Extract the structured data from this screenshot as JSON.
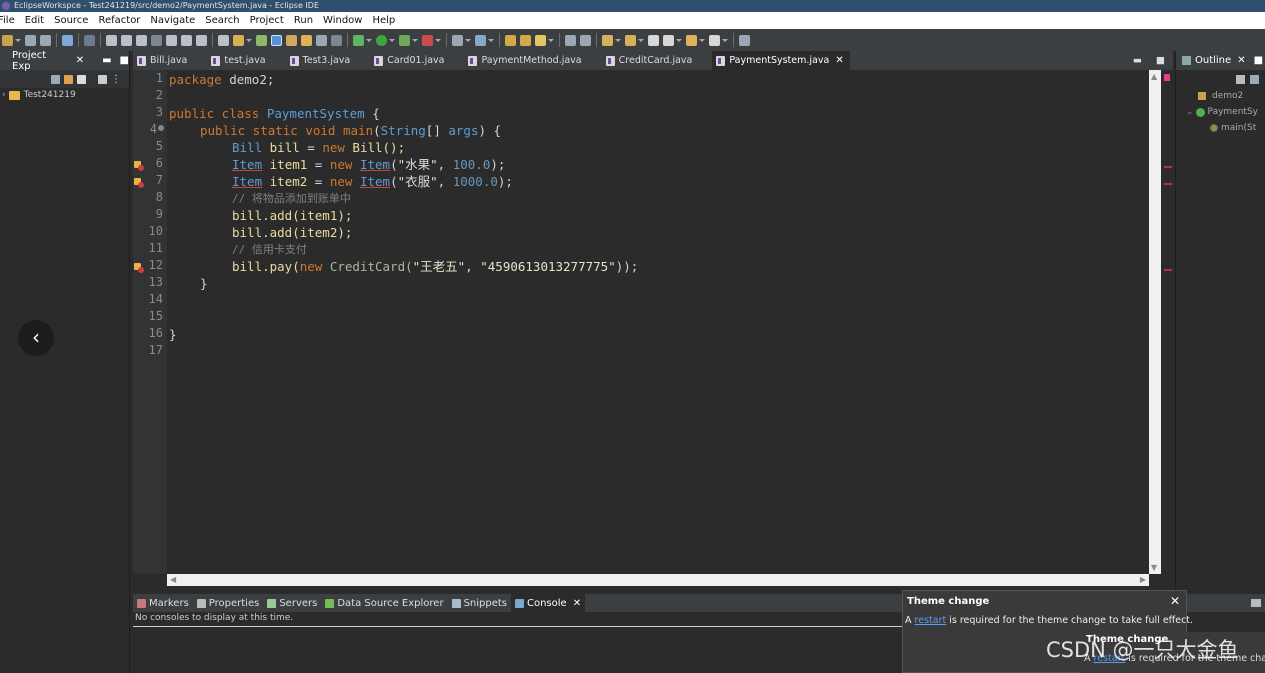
{
  "window": {
    "title": "EclipseWorkspce - Test241219/src/demo2/PaymentSystem.java - Eclipse IDE"
  },
  "menu": [
    "File",
    "Edit",
    "Source",
    "Refactor",
    "Navigate",
    "Search",
    "Project",
    "Run",
    "Window",
    "Help"
  ],
  "project_explorer": {
    "tab_label": "Project Exp",
    "project_name": "Test241219"
  },
  "editor_tabs": [
    {
      "label": "Bill.java",
      "active": false
    },
    {
      "label": "test.java",
      "active": false
    },
    {
      "label": "Test3.java",
      "active": false
    },
    {
      "label": "Card01.java",
      "active": false
    },
    {
      "label": "PaymentMethod.java",
      "active": false
    },
    {
      "label": "CreditCard.java",
      "active": false
    },
    {
      "label": "PaymentSystem.java",
      "active": true
    }
  ],
  "code": {
    "line_numbers": [
      "1",
      "2",
      "3",
      "4",
      "5",
      "6",
      "7",
      "8",
      "9",
      "10",
      "11",
      "12",
      "13",
      "14",
      "15",
      "16",
      "17"
    ],
    "l1_kw": "package",
    "l1_rest": " demo2;",
    "l3_kw": "public class",
    "l3_name": "PaymentSystem",
    "l3_rest": " {",
    "l4_kw": "public static void",
    "l4_fn": "main",
    "l4_p1": "(",
    "l4_type": "String",
    "l4_p2": "[] ",
    "l4_arg": "args",
    "l4_p3": ") {",
    "l5_type": "Bill",
    "l5_var": "bill",
    "l5_eq": " = ",
    "l5_new": "new",
    "l5_rest": " Bill();",
    "l6_type": "Item",
    "l6_var": "item1",
    "l6_eq": " = ",
    "l6_new": "new",
    "l6_type2": "Item",
    "l6_open": "(",
    "l6_str": "\"水果\"",
    "l6_comma": ", ",
    "l6_num": "100.0",
    "l6_close": ");",
    "l7_type": "Item",
    "l7_var": "item2",
    "l7_eq": " = ",
    "l7_new": "new",
    "l7_type2": "Item",
    "l7_open": "(",
    "l7_str": "\"衣服\"",
    "l7_comma": ", ",
    "l7_num": "1000.0",
    "l7_close": ");",
    "l8_comment": "// 将物品添加到账单中",
    "l9": "bill.add(item1);",
    "l10": "bill.add(item2);",
    "l11_comment": "// 信用卡支付",
    "l12_a": "bill.pay(",
    "l12_new": "new",
    "l12_cls": " CreditCard(",
    "l12_s1": "\"王老五\"",
    "l12_comma": ", ",
    "l12_s2": "\"4590613013277775\"",
    "l12_close": "));",
    "l13": "}",
    "l16": "}"
  },
  "outline": {
    "tab_label": "Outline",
    "items": [
      "demo2",
      "PaymentSy",
      "main(St"
    ]
  },
  "bottom_tabs": [
    {
      "label": "Markers",
      "active": false
    },
    {
      "label": "Properties",
      "active": false
    },
    {
      "label": "Servers",
      "active": false
    },
    {
      "label": "Data Source Explorer",
      "active": false
    },
    {
      "label": "Snippets",
      "active": false
    },
    {
      "label": "Console",
      "active": true
    }
  ],
  "console": {
    "message": "No consoles to display at this time."
  },
  "notification": {
    "title": "Theme change",
    "prefix": "A ",
    "link": "restart",
    "suffix": " is required for the theme change to take full effect.",
    "suffix_cut": " is required for the theme chan"
  },
  "watermark": "CSDN @一只大金鱼",
  "colors": {
    "keyword": "#cc7832",
    "type": "#5c9dd6",
    "string": "#6a8759",
    "comment": "#808080",
    "titlebar": "#2f4f6e"
  }
}
